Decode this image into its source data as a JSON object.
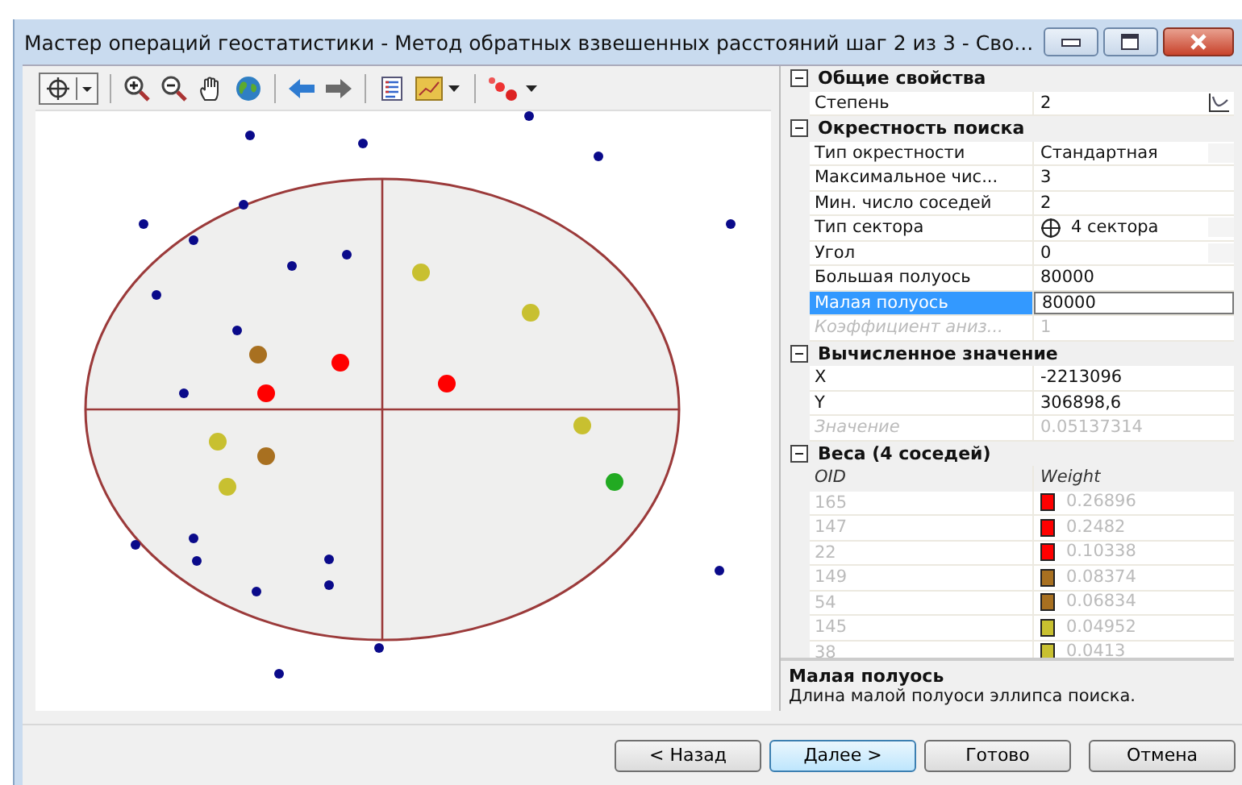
{
  "window": {
    "title": "Мастер операций геостатистики - Метод обратных взвешенных расстояний шаг 2 из 3 - Сво..."
  },
  "property_grid": {
    "sections": [
      {
        "title": "Общие свойства",
        "expanded": true,
        "rows": [
          {
            "label": "Степень",
            "value": "2",
            "kind": "graph",
            "selected": false,
            "disabled": false
          }
        ]
      },
      {
        "title": "Окрестность поиска",
        "expanded": true,
        "rows": [
          {
            "label": "Тип окрестности",
            "value": "Стандартная",
            "kind": "dropdown",
            "selected": false,
            "disabled": false
          },
          {
            "label": "Максимальное чис...",
            "value": "3",
            "kind": "plain",
            "selected": false,
            "disabled": false
          },
          {
            "label": "Мин. число соседей",
            "value": "2",
            "kind": "plain",
            "selected": false,
            "disabled": false
          },
          {
            "label": "Тип сектора",
            "value": "4 сектора",
            "kind": "sector",
            "selected": false,
            "disabled": false
          },
          {
            "label": "Угол",
            "value": "0",
            "kind": "dropdown",
            "selected": false,
            "disabled": false
          },
          {
            "label": "Большая полуось",
            "value": "80000",
            "kind": "plain",
            "selected": false,
            "disabled": false
          },
          {
            "label": "Малая полуось",
            "value": "80000",
            "kind": "plain",
            "selected": true,
            "disabled": false
          },
          {
            "label": "Коэффициент аниз...",
            "value": "1",
            "kind": "plain",
            "selected": false,
            "disabled": true
          }
        ]
      },
      {
        "title": "Вычисленное значение",
        "expanded": true,
        "rows": [
          {
            "label": "X",
            "value": "-2213096",
            "kind": "plain",
            "selected": false,
            "disabled": false
          },
          {
            "label": "Y",
            "value": "306898,6",
            "kind": "plain",
            "selected": false,
            "disabled": false
          },
          {
            "label": "Значение",
            "value": "0.05137314",
            "kind": "plain",
            "selected": false,
            "disabled": true
          }
        ]
      }
    ],
    "weights": {
      "title": "Веса (4 соседей)",
      "expanded": true,
      "columns": [
        "OID",
        "Weight"
      ],
      "rows": [
        {
          "oid": "165",
          "weight": "0.26896",
          "color": "#ff0000"
        },
        {
          "oid": "147",
          "weight": "0.2482",
          "color": "#ff0000"
        },
        {
          "oid": "22",
          "weight": "0.10338",
          "color": "#ff0000"
        },
        {
          "oid": "149",
          "weight": "0.08374",
          "color": "#a87020"
        },
        {
          "oid": "54",
          "weight": "0.06834",
          "color": "#a87020"
        },
        {
          "oid": "145",
          "weight": "0.04952",
          "color": "#c8c030"
        },
        {
          "oid": "38",
          "weight": "0.0413",
          "color": "#c8c030"
        }
      ]
    }
  },
  "description": {
    "title": "Малая полуось",
    "text": "Длина малой полуоси эллипса поиска."
  },
  "buttons": [
    {
      "label": "< Назад",
      "default": false
    },
    {
      "label": "Далее >",
      "default": true
    },
    {
      "label": "Готово",
      "default": false
    },
    {
      "label": "Отмена",
      "default": false
    }
  ]
}
